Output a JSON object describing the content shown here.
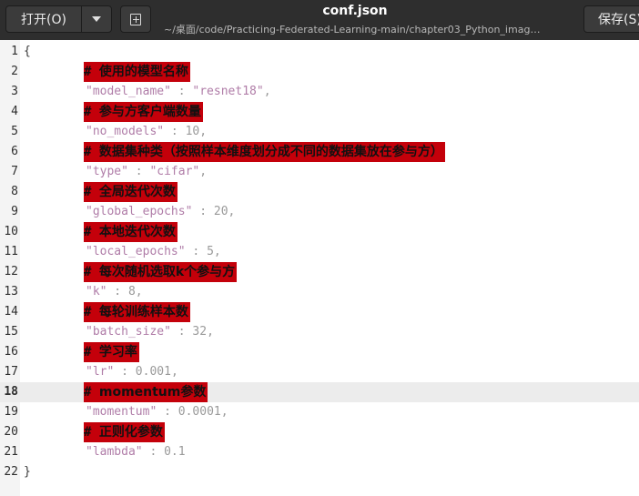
{
  "header": {
    "open_label": "打开(O)",
    "save_label": "保存(S)",
    "title": "conf.json",
    "subtitle": "~/桌面/code/Practicing-Federated-Learning-main/chapter03_Python_image…",
    "menu_icon": "chevron-down-icon",
    "new_tab_icon": "new-tab-icon"
  },
  "editor": {
    "current_line": 18,
    "lines": [
      {
        "no": "1",
        "text": "{"
      },
      {
        "no": "2",
        "comment": "使用的模型名称"
      },
      {
        "no": "3",
        "key": "\"model_name\"",
        "value": "\"resnet18\"",
        "comma": ","
      },
      {
        "no": "4",
        "comment": "参与方客户端数量"
      },
      {
        "no": "5",
        "key": "\"no_models\"",
        "value": "10",
        "comma": ","
      },
      {
        "no": "6",
        "comment": "数据集种类（按照样本维度划分成不同的数据集放在参与方）"
      },
      {
        "no": "7",
        "key": "\"type\"",
        "value": "\"cifar\"",
        "comma": ","
      },
      {
        "no": "8",
        "comment": "全局迭代次数"
      },
      {
        "no": "9",
        "key": "\"global_epochs\"",
        "value": "20",
        "comma": ","
      },
      {
        "no": "10",
        "comment": "本地迭代次数"
      },
      {
        "no": "11",
        "key": "\"local_epochs\"",
        "value": "5",
        "comma": ","
      },
      {
        "no": "12",
        "comment": "每次随机选取k个参与方"
      },
      {
        "no": "13",
        "key": "\"k\"",
        "value": "8",
        "comma": ","
      },
      {
        "no": "14",
        "comment": "每轮训练样本数"
      },
      {
        "no": "15",
        "key": "\"batch_size\"",
        "value": "32",
        "comma": ","
      },
      {
        "no": "16",
        "comment": "学习率"
      },
      {
        "no": "17",
        "key": "\"lr\"",
        "value": "0.001",
        "comma": ","
      },
      {
        "no": "18",
        "comment": "momentum参数"
      },
      {
        "no": "19",
        "key": "\"momentum\"",
        "value": "0.0001",
        "comma": ","
      },
      {
        "no": "20",
        "comment": "正则化参数"
      },
      {
        "no": "21",
        "key": "\"lambda\"",
        "value": "0.1",
        "comma": ""
      },
      {
        "no": "22",
        "text": "}"
      }
    ]
  }
}
